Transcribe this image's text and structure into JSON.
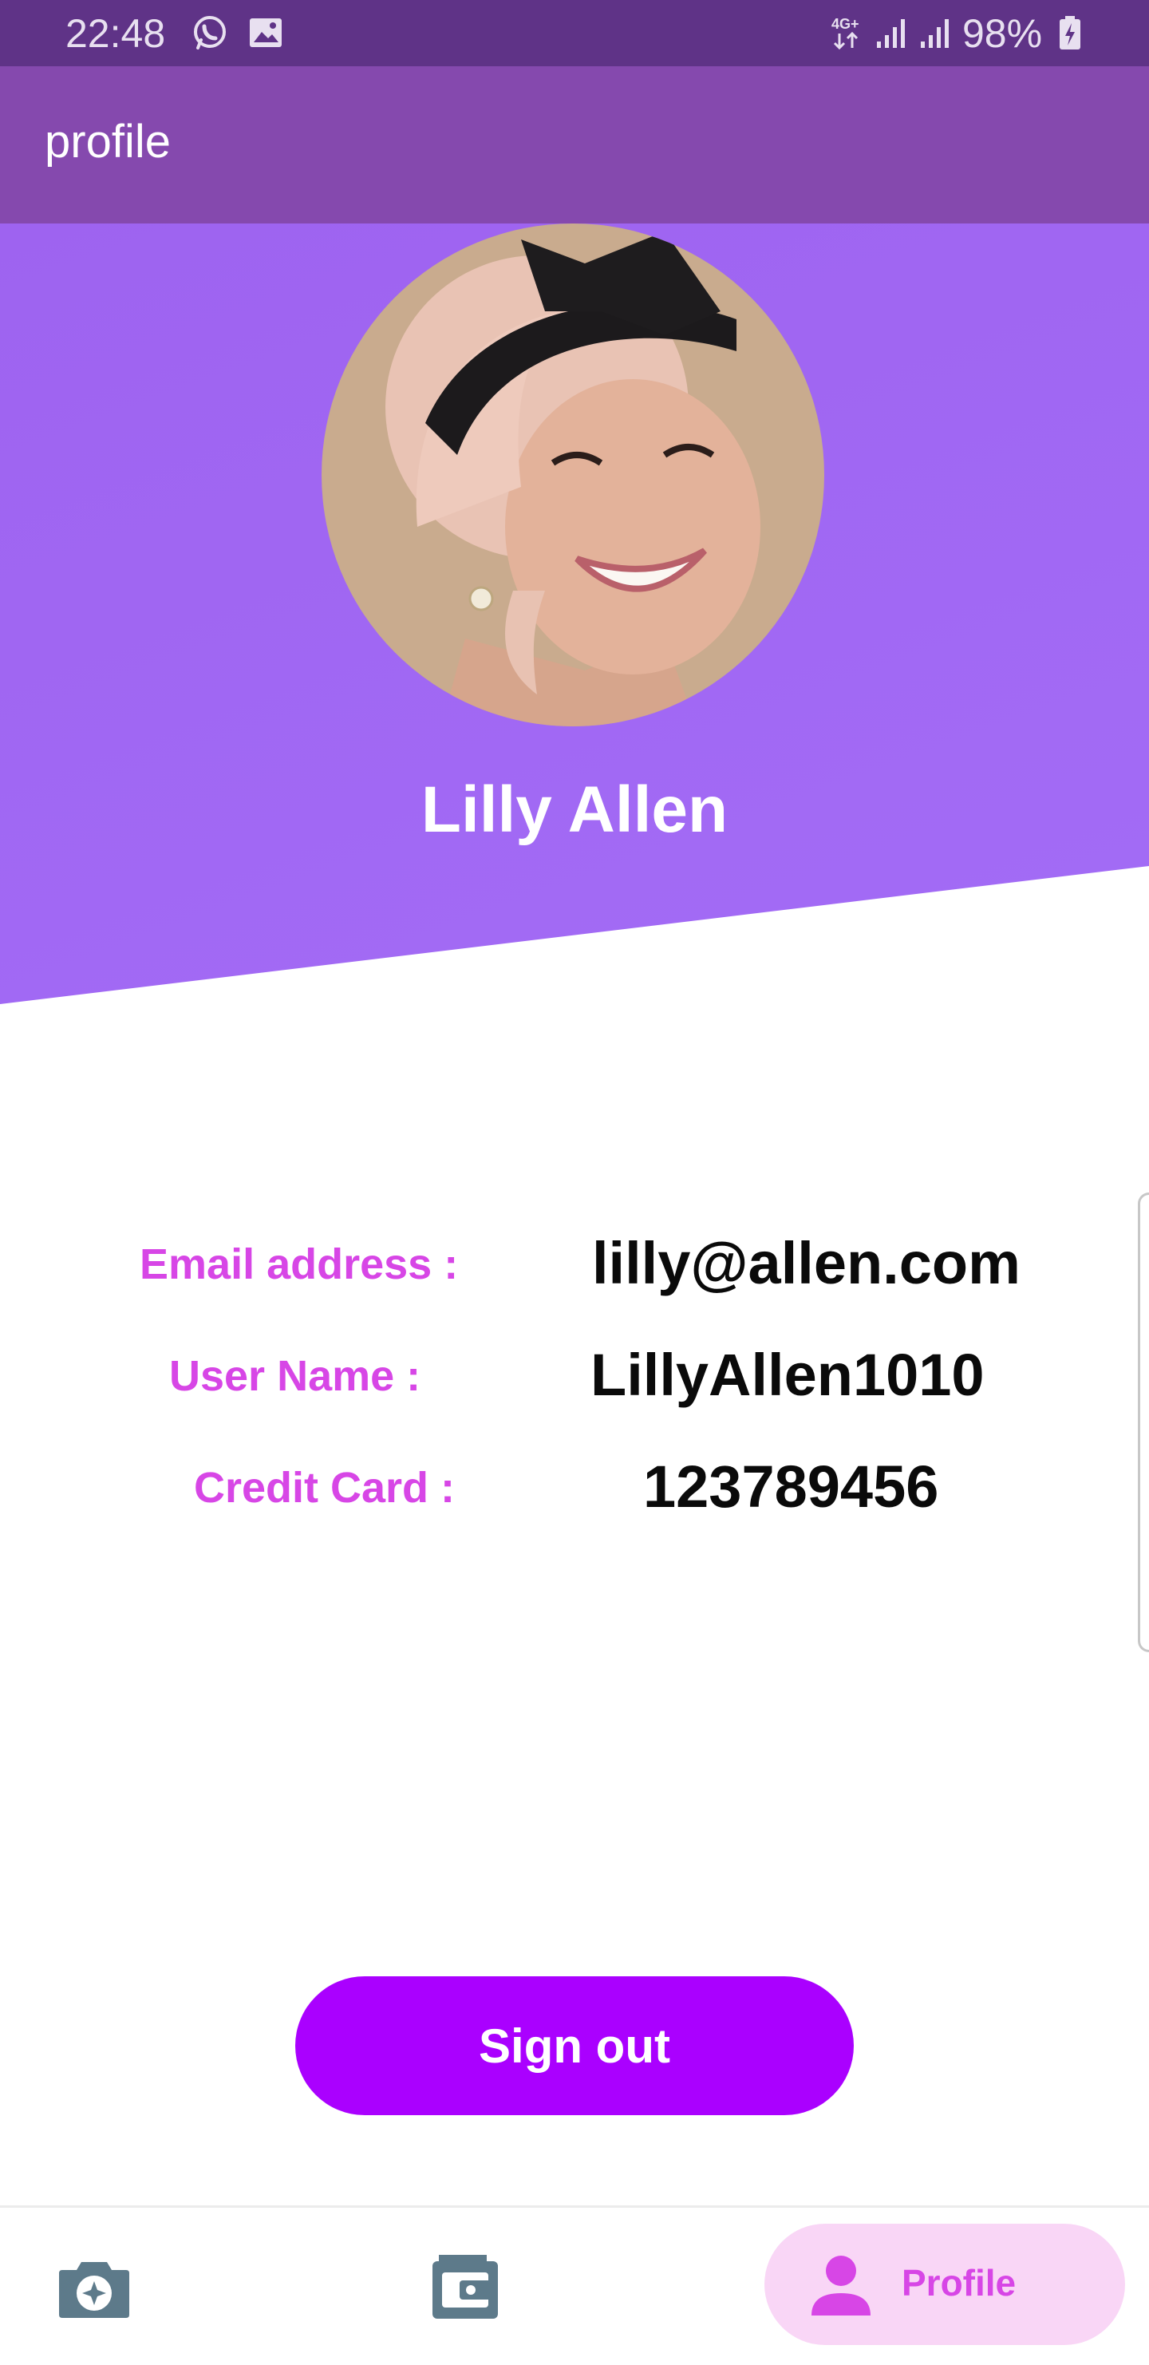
{
  "status_bar": {
    "time": "22:48",
    "battery": "98%",
    "icons": [
      "whatsapp-icon",
      "gallery-icon",
      "4g-icon",
      "signal-icon",
      "signal-icon",
      "battery-charging-icon"
    ]
  },
  "app_bar": {
    "title": "profile"
  },
  "header": {
    "name": "Lilly Allen"
  },
  "info": {
    "email_label": "Email address :",
    "email_value": "lilly@allen.com",
    "username_label": "User Name :",
    "username_value": "LillyAllen1010",
    "card_label": "Credit Card :",
    "card_value": "123789456"
  },
  "signout": {
    "label": "Sign out"
  },
  "bottom_nav": {
    "items": [
      {
        "icon": "camera-icon",
        "label": ""
      },
      {
        "icon": "wallet-icon",
        "label": ""
      },
      {
        "icon": "person-icon",
        "label": "Profile"
      }
    ]
  },
  "colors": {
    "status_bar": "#5f3387",
    "app_bar": "#8549ae",
    "header": "#a36cf6",
    "accent_label": "#d746e6",
    "signout_button": "#aa00ff",
    "active_nav_bg": "#f9d6f6"
  }
}
